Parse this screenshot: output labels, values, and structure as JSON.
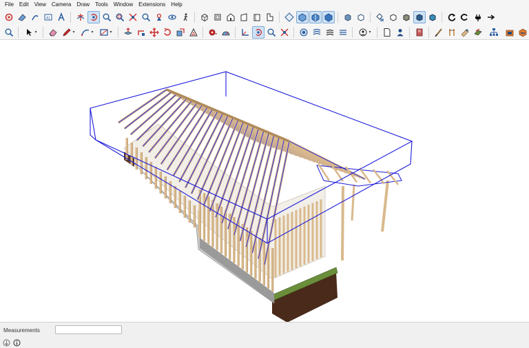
{
  "menu": [
    "File",
    "Edit",
    "View",
    "Camera",
    "Draw",
    "Tools",
    "Window",
    "Extensions",
    "Help"
  ],
  "toolbar_top": [
    "select-tool",
    "orbit-tool",
    "pan-tool",
    "zoom-tool",
    "zoom-window-tool",
    "zoom-extents-tool",
    "previous-view-tool",
    "position-camera-tool",
    "look-around-tool",
    "walk-tool",
    "section-plane-tool",
    "orbit-active-tool",
    "zoom-lens-tool",
    "magnify-tool",
    "zoom-all-tool",
    "zoom-selection-tool",
    "previous-tool",
    "walk-through-tool",
    "iso-view",
    "top-view",
    "front-view",
    "right-view",
    "back-view",
    "left-view",
    "xray-style",
    "back-edges-style",
    "wireframe-style",
    "hidden-line-style",
    "shaded-style",
    "shaded-textures-style",
    "monochrome-style",
    "reload-icon",
    "refresh-icon",
    "plug-icon"
  ],
  "toolbar_bottom": [
    "search-icon",
    "select-arrow-icon",
    "eraser-icon",
    "pencil-icon",
    "arc-icon",
    "rectangle-icon",
    "push-pull-icon",
    "move-icon",
    "rotate-icon",
    "scale-icon",
    "offset-icon",
    "tape-measure-icon",
    "protractor-icon",
    "axes-icon",
    "dimension-icon",
    "text-icon",
    "paint-bucket-icon",
    "orbit-icon",
    "pan-icon",
    "zoom-icon",
    "zoom-extents-icon",
    "layers-icon",
    "scenes-icon",
    "shadows-icon",
    "fog-icon",
    "styles-icon",
    "component-icon",
    "user-icon",
    "extension-icon",
    "brush-icon",
    "framing-icon",
    "lumber-icon",
    "material-icon",
    "hierarchy-icon",
    "warehouse-icon",
    "3d-icon",
    "share-icon"
  ],
  "status": {
    "measurements_label": "Measurements",
    "measurements_value": ""
  },
  "model": {
    "selection_color": "#1a1adb",
    "lumber_color": "#d9b98c",
    "lumber_dark": "#b08b5a",
    "foundation_color": "#c8c8c8",
    "grass_color": "#6b8e3a",
    "soil_color": "#4a2a1a"
  }
}
